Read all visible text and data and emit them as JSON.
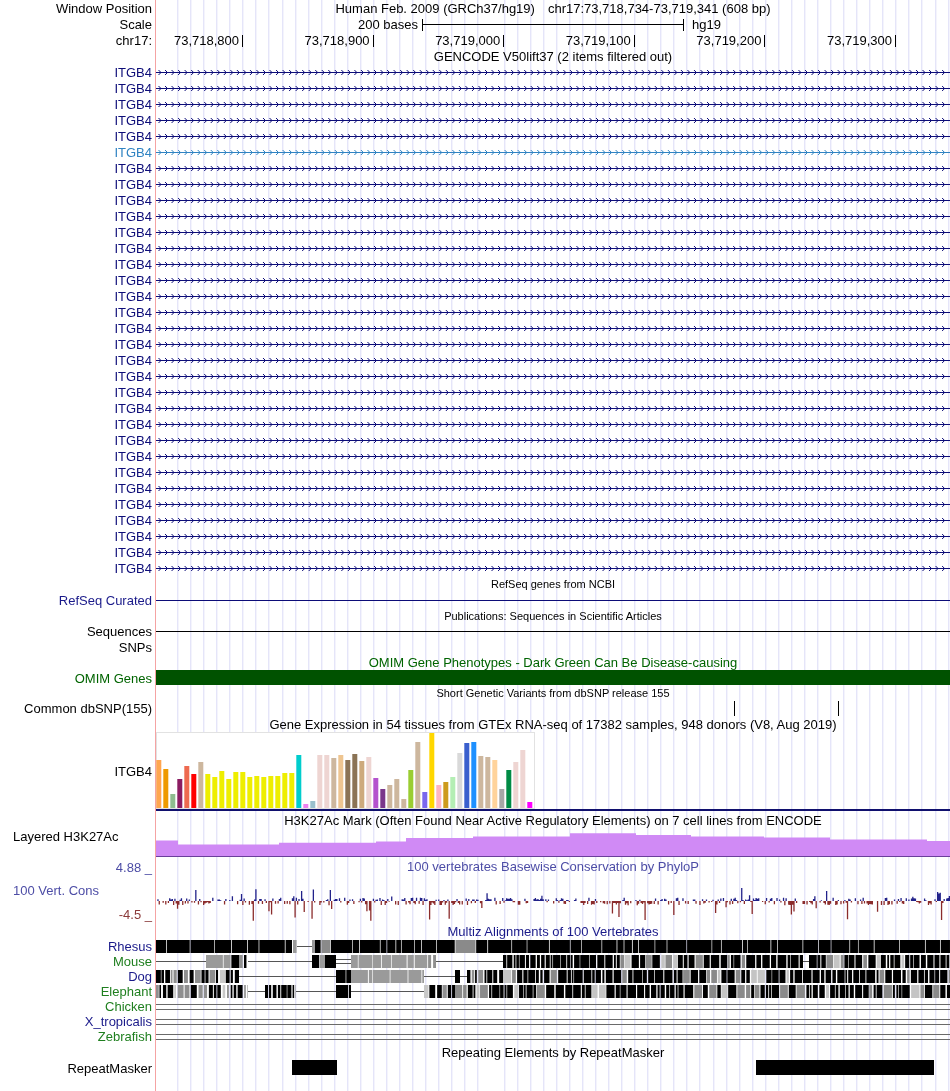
{
  "header": {
    "label": "Window Position",
    "assembly": "Human Feb. 2009 (GRCh37/hg19)",
    "position": "chr17:73,718,734-73,719,341 (608 bp)"
  },
  "scale": {
    "label": "Scale",
    "length": "200 bases",
    "assembly": "hg19"
  },
  "ruler": {
    "label": "chr17:",
    "ticks": [
      "73,718,800",
      "73,718,900",
      "73,719,000",
      "73,719,100",
      "73,719,200",
      "73,719,300"
    ]
  },
  "gencode": {
    "title": "GENCODE V50lift37 (2 items filtered out)",
    "items": [
      {
        "label": "ITGB4",
        "color": "#0c0c78"
      },
      {
        "label": "ITGB4",
        "color": "#0c0c78"
      },
      {
        "label": "ITGB4",
        "color": "#0c0c78"
      },
      {
        "label": "ITGB4",
        "color": "#0c0c78"
      },
      {
        "label": "ITGB4",
        "color": "#0c0c78"
      },
      {
        "label": "ITGB4",
        "color": "#2f83c2"
      },
      {
        "label": "ITGB4",
        "color": "#0c0c78"
      },
      {
        "label": "ITGB4",
        "color": "#0c0c78"
      },
      {
        "label": "ITGB4",
        "color": "#0c0c78"
      },
      {
        "label": "ITGB4",
        "color": "#0c0c78"
      },
      {
        "label": "ITGB4",
        "color": "#0c0c78"
      },
      {
        "label": "ITGB4",
        "color": "#0c0c78"
      },
      {
        "label": "ITGB4",
        "color": "#0c0c78"
      },
      {
        "label": "ITGB4",
        "color": "#0c0c78"
      },
      {
        "label": "ITGB4",
        "color": "#0c0c78"
      },
      {
        "label": "ITGB4",
        "color": "#0c0c78"
      },
      {
        "label": "ITGB4",
        "color": "#0c0c78"
      },
      {
        "label": "ITGB4",
        "color": "#0c0c78"
      },
      {
        "label": "ITGB4",
        "color": "#0c0c78"
      },
      {
        "label": "ITGB4",
        "color": "#0c0c78"
      },
      {
        "label": "ITGB4",
        "color": "#0c0c78"
      },
      {
        "label": "ITGB4",
        "color": "#0c0c78"
      },
      {
        "label": "ITGB4",
        "color": "#0c0c78"
      },
      {
        "label": "ITGB4",
        "color": "#0c0c78"
      },
      {
        "label": "ITGB4",
        "color": "#0c0c78"
      },
      {
        "label": "ITGB4",
        "color": "#0c0c78"
      },
      {
        "label": "ITGB4",
        "color": "#0c0c78"
      },
      {
        "label": "ITGB4",
        "color": "#0c0c78"
      },
      {
        "label": "ITGB4",
        "color": "#0c0c78"
      },
      {
        "label": "ITGB4",
        "color": "#0c0c78"
      },
      {
        "label": "ITGB4",
        "color": "#0c0c78"
      },
      {
        "label": "ITGB4",
        "color": "#0c0c78"
      }
    ]
  },
  "refseq": {
    "title": "RefSeq genes from NCBI",
    "label": "RefSeq Curated"
  },
  "publications": {
    "title": "Publications: Sequences in Scientific Articles",
    "subtracks": [
      {
        "label": "Sequences",
        "kind": "line"
      },
      {
        "label": "SNPs",
        "kind": "empty"
      }
    ]
  },
  "omim": {
    "title": "OMIM Gene Phenotypes - Dark Green Can Be Disease-causing",
    "label": "OMIM Genes"
  },
  "dbsnp": {
    "title": "Short Genetic Variants from dbSNP release 155",
    "label": "Common dbSNP(155)"
  },
  "gtex": {
    "title": "Gene Expression in 54 tissues from GTEx RNA-seq of 17382 samples, 948 donors (V8, Aug 2019)",
    "label": "ITGB4"
  },
  "h3k27ac": {
    "title": "H3K27Ac Mark (Often Found Near Active Regulatory Elements) on 7 cell lines from ENCODE",
    "label": "Layered H3K27Ac"
  },
  "conservation": {
    "title": "100 vertebrates Basewise Conservation by PhyloP",
    "label": "100 Vert. Cons",
    "max_label": "4.88 _",
    "min_label": "-4.5 _"
  },
  "multiz": {
    "title": "Multiz Alignments of 100 Vertebrates",
    "species": [
      {
        "name": "Rhesus",
        "color": "#1a1a8a",
        "kind": "aligned"
      },
      {
        "name": "Mouse",
        "color": "#1f7f1f",
        "kind": "aligned"
      },
      {
        "name": "Dog",
        "color": "#1a1a8a",
        "kind": "aligned"
      },
      {
        "name": "Elephant",
        "color": "#1f7f1f",
        "kind": "aligned"
      },
      {
        "name": "Chicken",
        "color": "#1f7f1f",
        "kind": "unaligned"
      },
      {
        "name": "X_tropicalis",
        "color": "#1a1a8a",
        "kind": "unaligned"
      },
      {
        "name": "Zebrafish",
        "color": "#1f7f1f",
        "kind": "unaligned"
      }
    ]
  },
  "repeatmasker": {
    "title": "Repeating Elements by RepeatMasker",
    "label": "RepeatMasker"
  }
}
